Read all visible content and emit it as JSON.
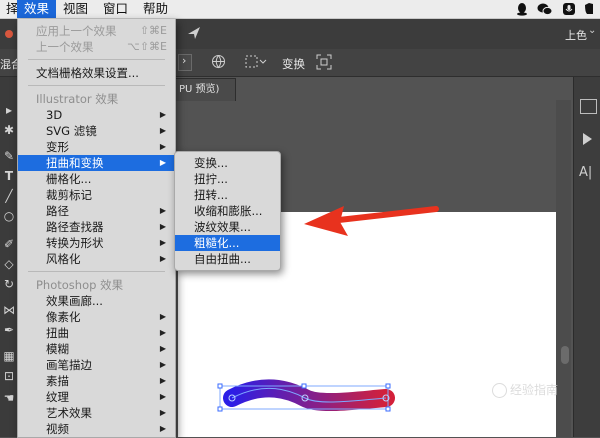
{
  "menubar": {
    "items": [
      {
        "label": "择"
      },
      {
        "label": "效果"
      },
      {
        "label": "视图"
      },
      {
        "label": "窗口"
      },
      {
        "label": "帮助"
      }
    ]
  },
  "toolbar": {
    "workspace_label": "上色",
    "left_partial_label": "混合",
    "transform_label": "变换",
    "tab_label": "PU 预览)"
  },
  "effect_menu": {
    "items": [
      {
        "label": "应用上一个效果",
        "shortcut": "⇧⌘E",
        "state": "disabled"
      },
      {
        "label": "上一个效果",
        "shortcut": "⌥⇧⌘E",
        "state": "disabled"
      },
      {
        "label": "文档栅格效果设置...",
        "state": "normal"
      },
      {
        "label": "Illustrator 效果",
        "state": "header"
      },
      {
        "label": "3D",
        "submenu": true
      },
      {
        "label": "SVG 滤镜",
        "submenu": true
      },
      {
        "label": "变形",
        "submenu": true
      },
      {
        "label": "扭曲和变换",
        "submenu": true,
        "state": "highlighted"
      },
      {
        "label": "栅格化...",
        "submenu": false
      },
      {
        "label": "裁剪标记",
        "submenu": false
      },
      {
        "label": "路径",
        "submenu": true
      },
      {
        "label": "路径查找器",
        "submenu": true
      },
      {
        "label": "转换为形状",
        "submenu": true
      },
      {
        "label": "风格化",
        "submenu": true
      },
      {
        "label": "Photoshop 效果",
        "state": "header"
      },
      {
        "label": "效果画廊...",
        "submenu": false
      },
      {
        "label": "像素化",
        "submenu": true
      },
      {
        "label": "扭曲",
        "submenu": true
      },
      {
        "label": "模糊",
        "submenu": true
      },
      {
        "label": "画笔描边",
        "submenu": true
      },
      {
        "label": "素描",
        "submenu": true
      },
      {
        "label": "纹理",
        "submenu": true
      },
      {
        "label": "艺术效果",
        "submenu": true
      },
      {
        "label": "视频",
        "submenu": true
      }
    ]
  },
  "submenu": {
    "items": [
      {
        "label": "变换..."
      },
      {
        "label": "扭拧..."
      },
      {
        "label": "扭转..."
      },
      {
        "label": "收缩和膨胀..."
      },
      {
        "label": "波纹效果..."
      },
      {
        "label": "粗糙化...",
        "state": "highlighted"
      },
      {
        "label": "自由扭曲..."
      }
    ]
  },
  "watermark": {
    "text": "经验指南"
  },
  "colors": {
    "menu_highlight": "#1d6de0",
    "annotation_arrow": "#e8321e",
    "stroke_start": "#2b1ee6",
    "stroke_end": "#d3203a"
  }
}
